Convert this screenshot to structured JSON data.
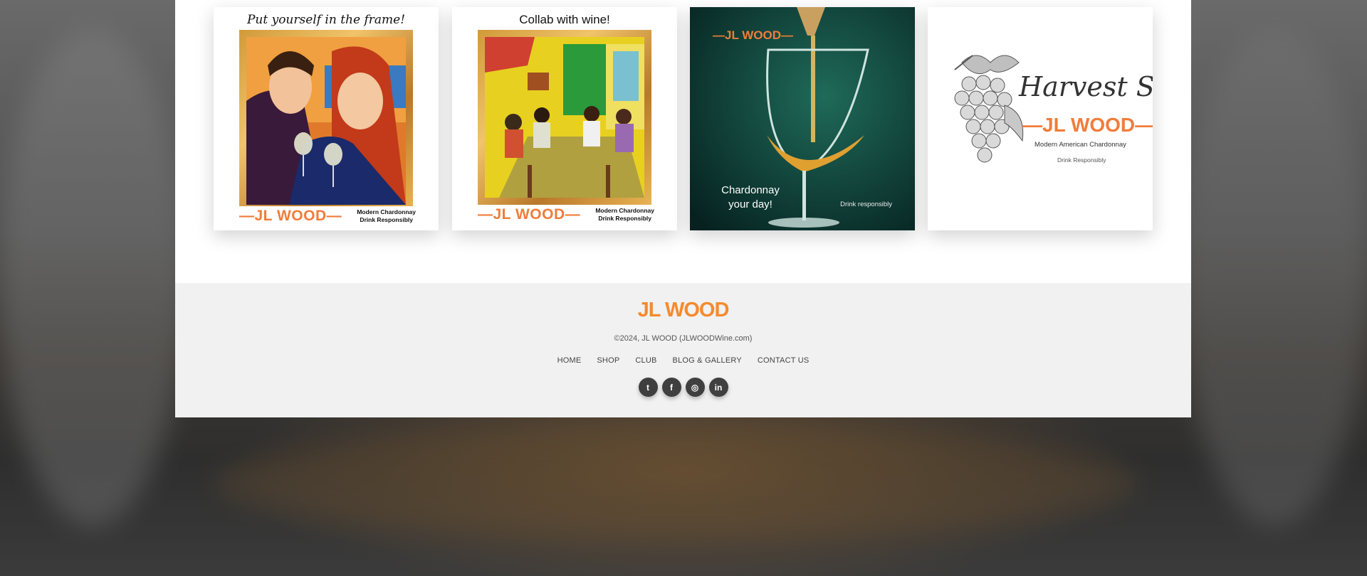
{
  "gallery": {
    "tiles": [
      {
        "title": "Put yourself in the frame!",
        "brand": "—JL WOOD—",
        "sub_line1": "Modern Chardonnay",
        "sub_line2": "Drink Responsibly"
      },
      {
        "title": "Collab with wine!",
        "brand": "—JL WOOD—",
        "sub_line1": "Modern Chardonnay",
        "sub_line2": "Drink Responsibly"
      },
      {
        "brand": "—JL WOOD—",
        "caption": "Chardonnay your day!",
        "drink": "Drink responsibly"
      },
      {
        "title": "Harvest Sale",
        "brand": "—JL WOOD—",
        "sub_line1": "Modern American Chardonnay",
        "sub_line2": "Drink Responsibly"
      }
    ]
  },
  "footer": {
    "logo": "JL WOOD",
    "copyright": "©2024, JL WOOD (JLWOODWine.com)",
    "nav": [
      "HOME",
      "SHOP",
      "CLUB",
      "BLOG & GALLERY",
      "CONTACT US"
    ],
    "social": [
      {
        "icon": "twitter-icon",
        "glyph": "t"
      },
      {
        "icon": "facebook-icon",
        "glyph": "f"
      },
      {
        "icon": "instagram-icon",
        "glyph": "◎"
      },
      {
        "icon": "linkedin-icon",
        "glyph": "in"
      }
    ]
  },
  "colors": {
    "brand_orange": "#f07d3a",
    "footer_bg": "#f1f1f1",
    "social_bg": "#3f3f3f"
  }
}
